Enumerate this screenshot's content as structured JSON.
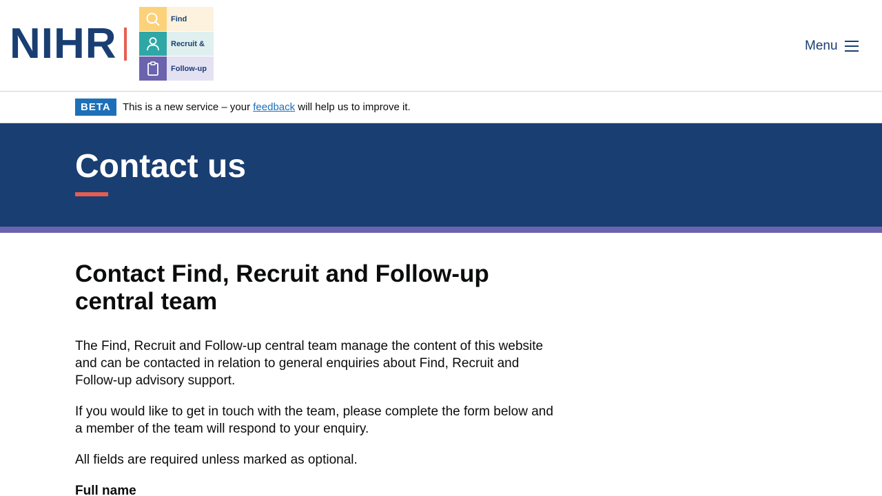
{
  "header": {
    "nihr_logo_text": "NIHR",
    "frf_logo": {
      "rows": [
        {
          "label": "Find",
          "icon": "search-icon"
        },
        {
          "label": "Recruit &",
          "icon": "person-icon"
        },
        {
          "label": "Follow-up",
          "icon": "clipboard-icon"
        }
      ]
    },
    "menu_label": "Menu"
  },
  "beta": {
    "tag": "BETA",
    "text_before": "This is a new service – your ",
    "link_text": "feedback",
    "text_after": " will help us to improve it."
  },
  "hero": {
    "title": "Contact us"
  },
  "main": {
    "heading": "Contact Find, Recruit and Follow-up central team",
    "paragraphs": [
      "The Find, Recruit and Follow-up central team manage the content of this website and can be contacted in relation to general enquiries about Find, Recruit and Follow-up advisory support.",
      "If you would like to get in touch with the team, please complete the form below and a member of the team will respond to your enquiry.",
      "All fields are required unless marked as optional."
    ],
    "first_field_label": "Full name"
  },
  "colors": {
    "brand_navy": "#193e72",
    "accent_red": "#e65d4f",
    "purple_stripe": "#6b63ad",
    "link_blue": "#1d70b8"
  }
}
